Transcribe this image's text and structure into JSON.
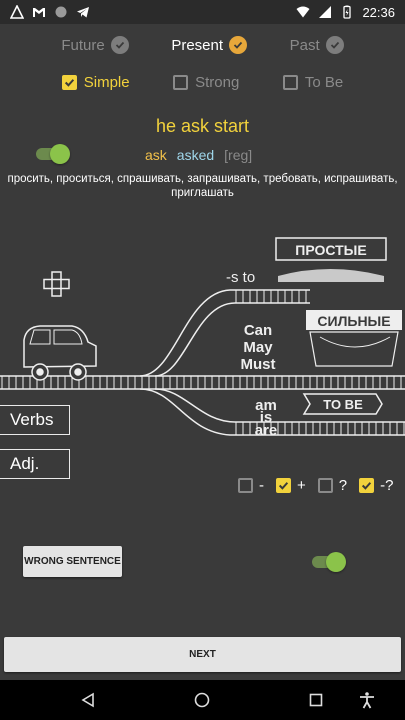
{
  "statusbar": {
    "time": "22:36"
  },
  "tenses": [
    {
      "label": "Future",
      "active": false
    },
    {
      "label": "Present",
      "active": true
    },
    {
      "label": "Past",
      "active": false
    }
  ],
  "types": [
    {
      "label": "Simple",
      "active": true
    },
    {
      "label": "Strong",
      "active": false
    },
    {
      "label": "To Be",
      "active": false
    }
  ],
  "sentence": "he ask start",
  "forms": {
    "base": "ask",
    "past": "asked",
    "tag": "[reg]"
  },
  "translation": "просить, проситься, спрашивать, запрашивать, требовать, испрашивать, приглашать",
  "diagram": {
    "plus": "+",
    "s_to": "-s to",
    "prostye": "ПРОСТЫЕ",
    "silnye": "СИЛЬНЫЕ",
    "modals": [
      "Can",
      "May",
      "Must"
    ],
    "to_be": [
      "am",
      "is",
      "are"
    ],
    "to_be_sign": "TO BE"
  },
  "side_buttons": {
    "verbs": "Verbs",
    "adj": "Adj."
  },
  "filters": [
    {
      "label": "-",
      "checked": false
    },
    {
      "label": "+",
      "checked": true
    },
    {
      "label": "?",
      "checked": false
    },
    {
      "label": "-?",
      "checked": true
    }
  ],
  "buttons": {
    "wrong": "WRONG SENTENCE",
    "next": "NEXT"
  },
  "colors": {
    "accent_yellow": "#f2d23c",
    "accent_orange": "#e7a73a",
    "past_blue": "#9fd6ea",
    "switch_green": "#8bc34a"
  }
}
